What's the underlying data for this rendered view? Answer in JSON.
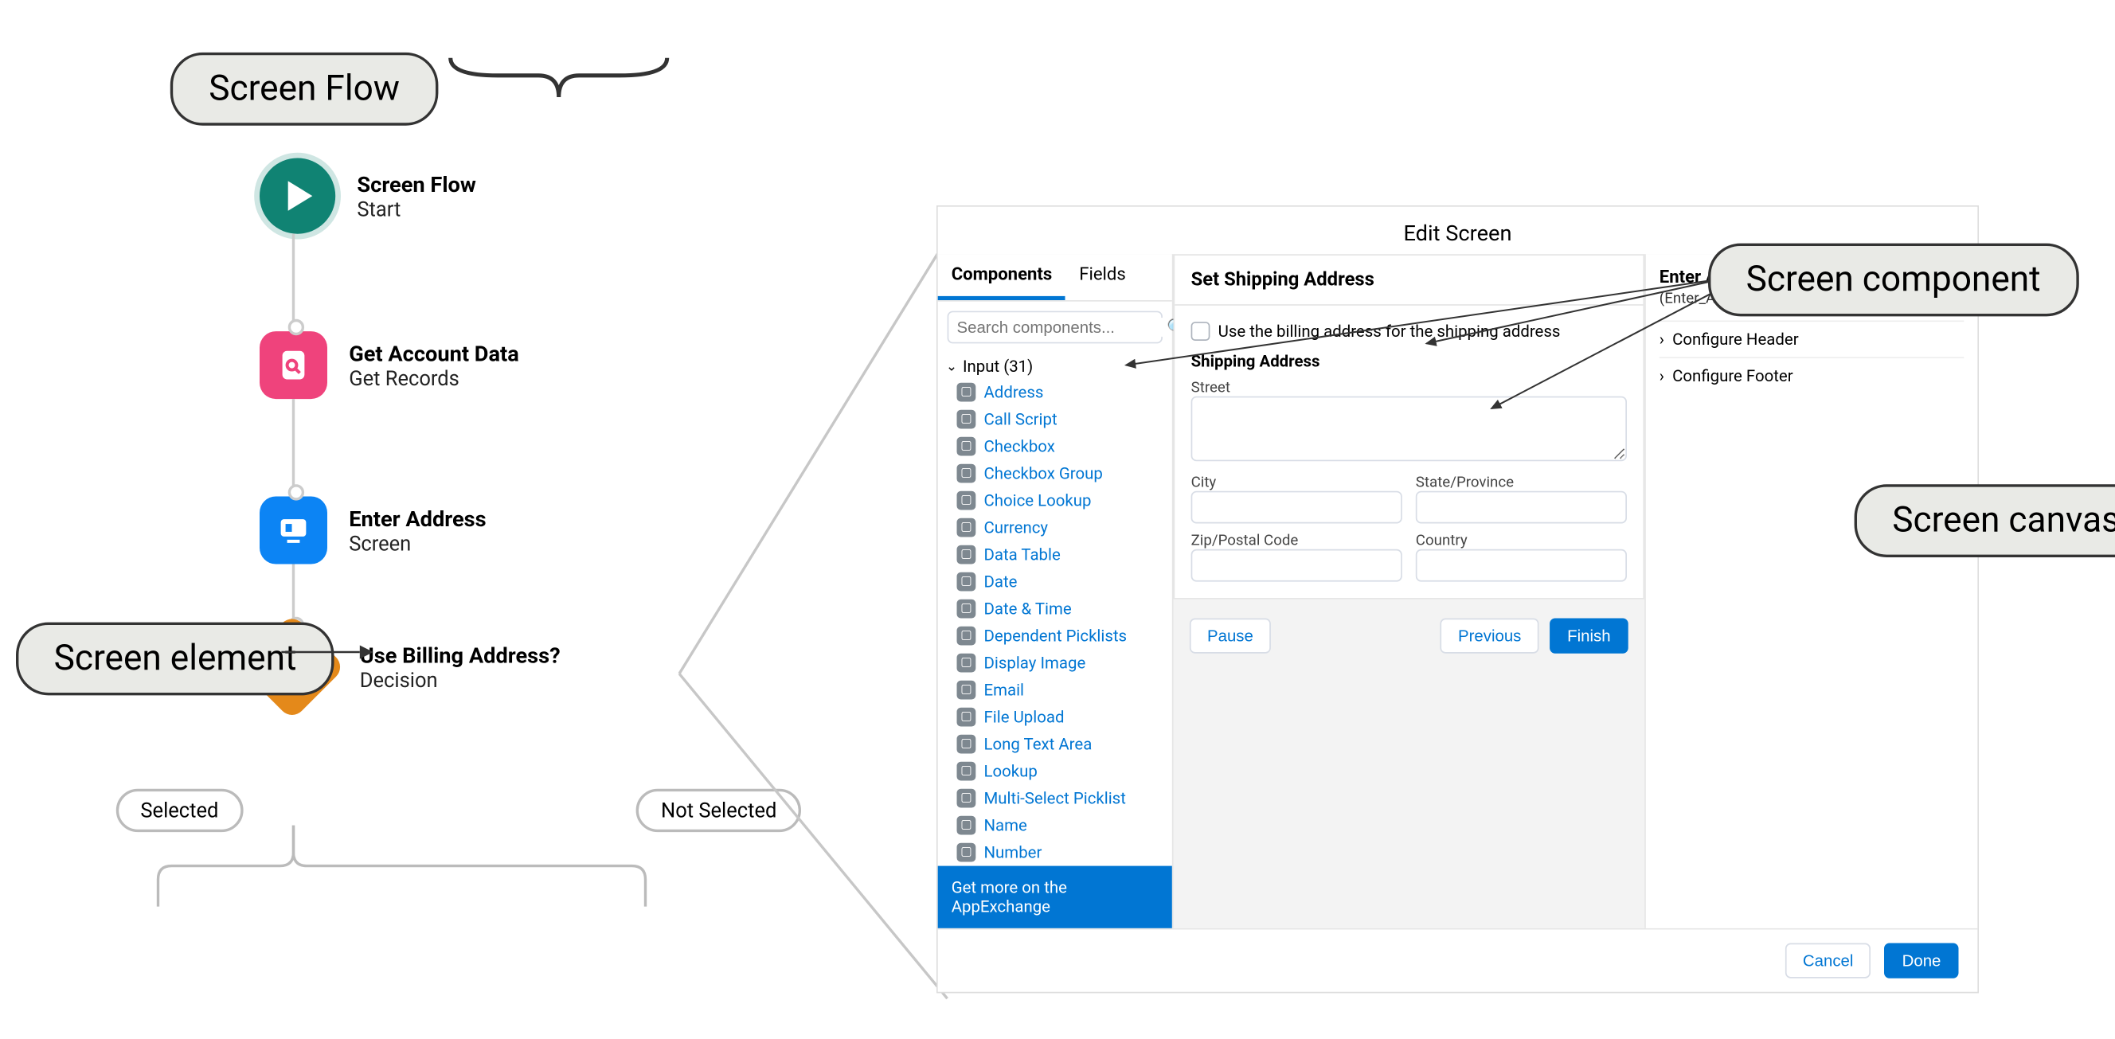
{
  "labels": {
    "screen_flow": "Screen Flow",
    "screen_element": "Screen element",
    "screen_component": "Screen component",
    "screen_canvas": "Screen canvas"
  },
  "flow": {
    "start": {
      "title": "Screen Flow",
      "sub": "Start"
    },
    "get_records": {
      "title": "Get Account Data",
      "sub": "Get Records"
    },
    "screen": {
      "title": "Enter Address",
      "sub": "Screen"
    },
    "decision": {
      "title": "Use Billing Address?",
      "sub": "Decision"
    },
    "branch_left": "Selected",
    "branch_right": "Not Selected"
  },
  "modal": {
    "title": "Edit Screen",
    "tabs": {
      "components": "Components",
      "fields": "Fields"
    },
    "search_placeholder": "Search components...",
    "group_label": "Input (31)",
    "components": [
      "Address",
      "Call Script",
      "Checkbox",
      "Checkbox Group",
      "Choice Lookup",
      "Currency",
      "Data Table",
      "Date",
      "Date & Time",
      "Dependent Picklists",
      "Display Image",
      "Email",
      "File Upload",
      "Long Text Area",
      "Lookup",
      "Multi-Select Picklist",
      "Name",
      "Number"
    ],
    "appexchange": "Get more on the AppExchange",
    "canvas": {
      "title": "Set Shipping Address",
      "use_billing": "Use the billing address for the shipping address",
      "section": "Shipping Address",
      "street": "Street",
      "city": "City",
      "state": "State/Province",
      "zip": "Zip/Postal Code",
      "country": "Country",
      "pause": "Pause",
      "previous": "Previous",
      "finish": "Finish"
    },
    "right": {
      "title": "Enter Address",
      "api": "(Enter_Address)",
      "cfg_header": "Configure Header",
      "cfg_footer": "Configure Footer"
    },
    "footer": {
      "cancel": "Cancel",
      "done": "Done"
    }
  }
}
